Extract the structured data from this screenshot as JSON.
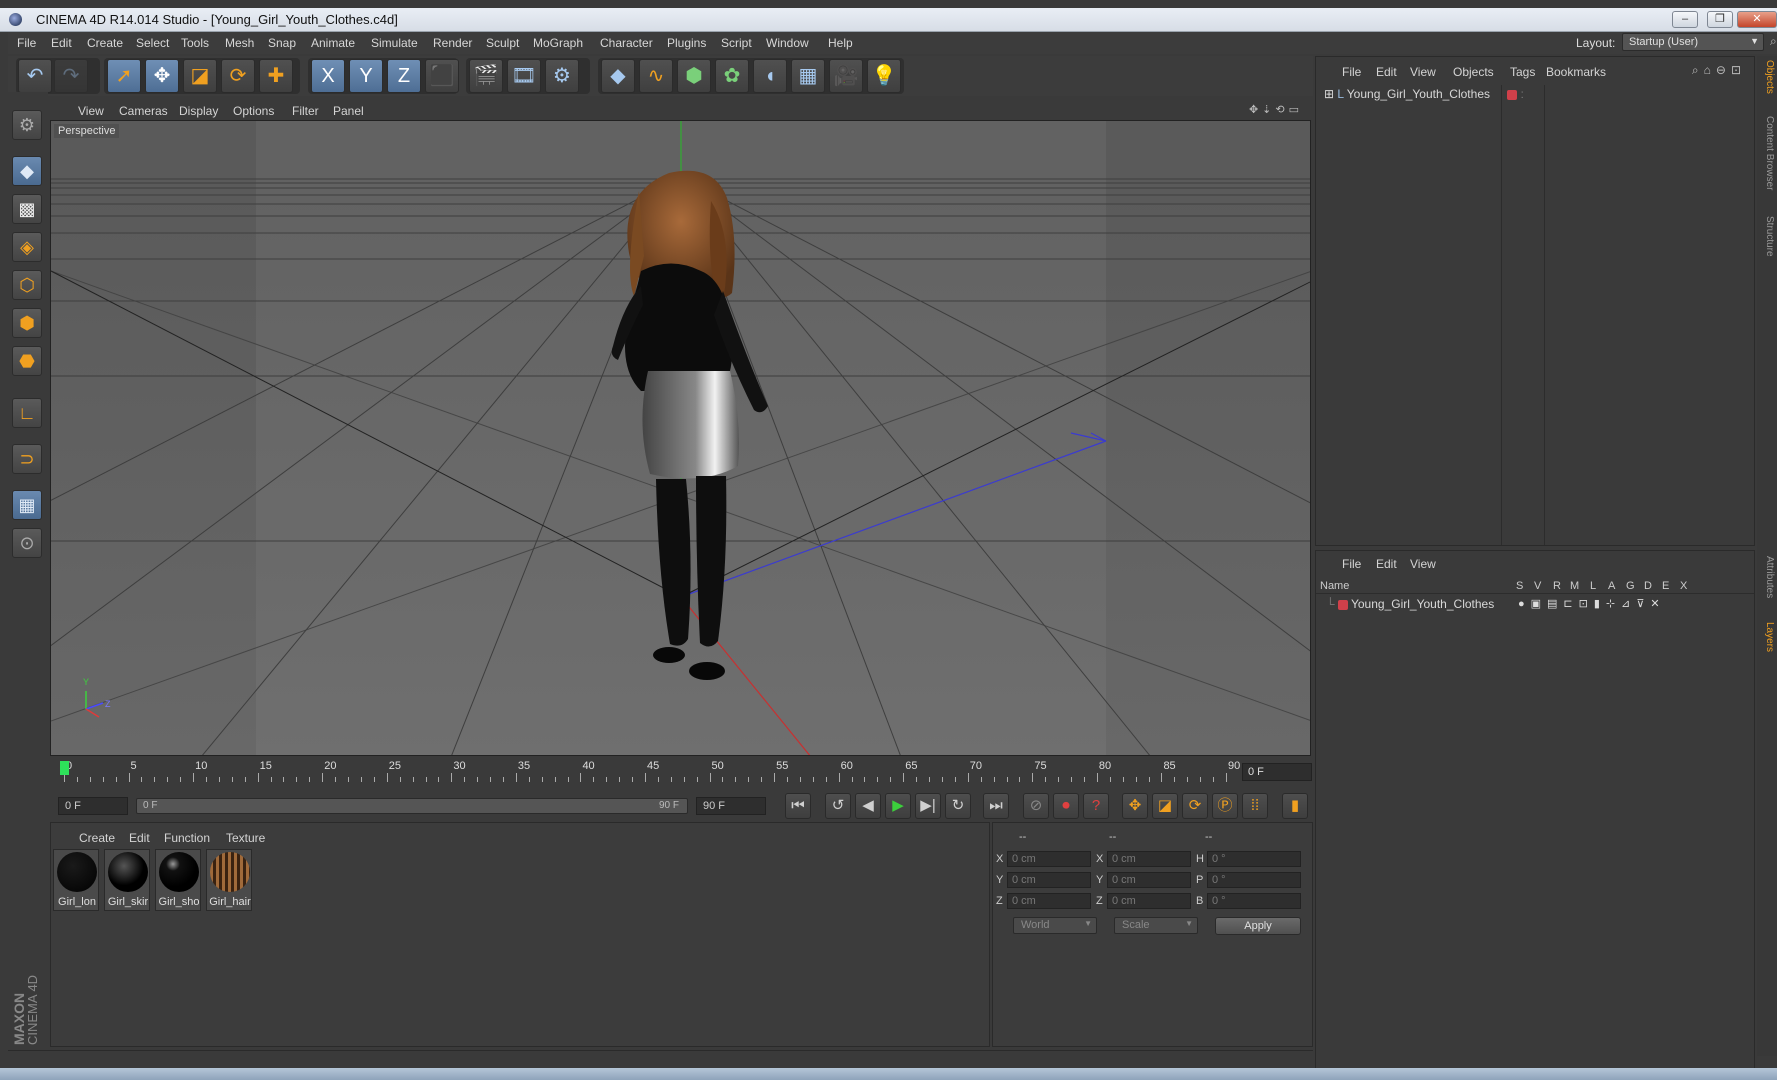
{
  "window": {
    "title": "CINEMA 4D R14.014 Studio - [Young_Girl_Youth_Clothes.c4d]"
  },
  "menubar": {
    "items": [
      "File",
      "Edit",
      "Create",
      "Select",
      "Tools",
      "Mesh",
      "Snap",
      "Animate",
      "Simulate",
      "Render",
      "Sculpt",
      "MoGraph",
      "Character",
      "Plugins",
      "Script",
      "Window",
      "Help"
    ],
    "layout_label": "Layout:",
    "layout_value": "Startup (User)"
  },
  "toolbar": {
    "icons": [
      "undo-icon",
      "redo-icon",
      "select-icon",
      "move-icon",
      "scale-icon",
      "rotate-icon",
      "add-icon",
      "x-axis-icon",
      "y-axis-icon",
      "z-axis-icon",
      "coordinate-system-icon",
      "render-view-icon",
      "render-picture-viewer-icon",
      "edit-render-settings-icon",
      "cube-icon",
      "spline-icon",
      "nurbs-icon",
      "array-icon",
      "deformer-icon",
      "scene-icon",
      "camera-icon",
      "light-icon"
    ],
    "axis_labels": [
      "X",
      "Y",
      "Z"
    ]
  },
  "viewport": {
    "menu": [
      "View",
      "Cameras",
      "Display",
      "Options",
      "Filter",
      "Panel"
    ],
    "label": "Perspective",
    "axis_gizmo": {
      "y": "Y",
      "z": "Z"
    }
  },
  "timeline": {
    "ticks": [
      "0",
      "5",
      "10",
      "15",
      "20",
      "25",
      "30",
      "35",
      "40",
      "45",
      "50",
      "55",
      "60",
      "65",
      "70",
      "75",
      "80",
      "85",
      "90"
    ],
    "current_frame": "0 F",
    "start_field": "0 F",
    "range_start": "0 F",
    "range_end": "90 F",
    "end_field": "90 F"
  },
  "materials": {
    "menu": [
      "Create",
      "Edit",
      "Function",
      "Texture"
    ],
    "items": [
      {
        "name": "Girl_lon",
        "color": "#000000"
      },
      {
        "name": "Girl_skir",
        "color": "#111111"
      },
      {
        "name": "Girl_sho",
        "color": "#050505"
      },
      {
        "name": "Girl_hair",
        "color": "#6b4228"
      }
    ]
  },
  "coordinates": {
    "headers": [
      "--",
      "--",
      "--"
    ],
    "rows": [
      {
        "l1": "X",
        "v1": "0 cm",
        "l2": "X",
        "v2": "0 cm",
        "l3": "H",
        "v3": "0 °"
      },
      {
        "l1": "Y",
        "v1": "0 cm",
        "l2": "Y",
        "v2": "0 cm",
        "l3": "P",
        "v3": "0 °"
      },
      {
        "l1": "Z",
        "v1": "0 cm",
        "l2": "Z",
        "v2": "0 cm",
        "l3": "B",
        "v3": "0 °"
      }
    ],
    "mode": "World",
    "transform": "Scale",
    "apply": "Apply"
  },
  "objects_panel": {
    "menu": [
      "File",
      "Edit",
      "View",
      "Objects",
      "Tags",
      "Bookmarks"
    ],
    "object_name": "Young_Girl_Youth_Clothes"
  },
  "layers_panel": {
    "menu": [
      "File",
      "Edit",
      "View"
    ],
    "columns": [
      "Name",
      "S",
      "V",
      "R",
      "M",
      "L",
      "A",
      "G",
      "D",
      "E",
      "X"
    ],
    "layer_name": "Young_Girl_Youth_Clothes"
  },
  "side_tabs": [
    "Objects",
    "Content Browser",
    "Structure",
    "Attributes",
    "Layers"
  ],
  "branding": {
    "maxon": "MAXON",
    "product": "CINEMA 4D"
  },
  "colors": {
    "accent": "#f0a020",
    "tag_red": "#d0404a",
    "play_green": "#3ccf3c"
  }
}
